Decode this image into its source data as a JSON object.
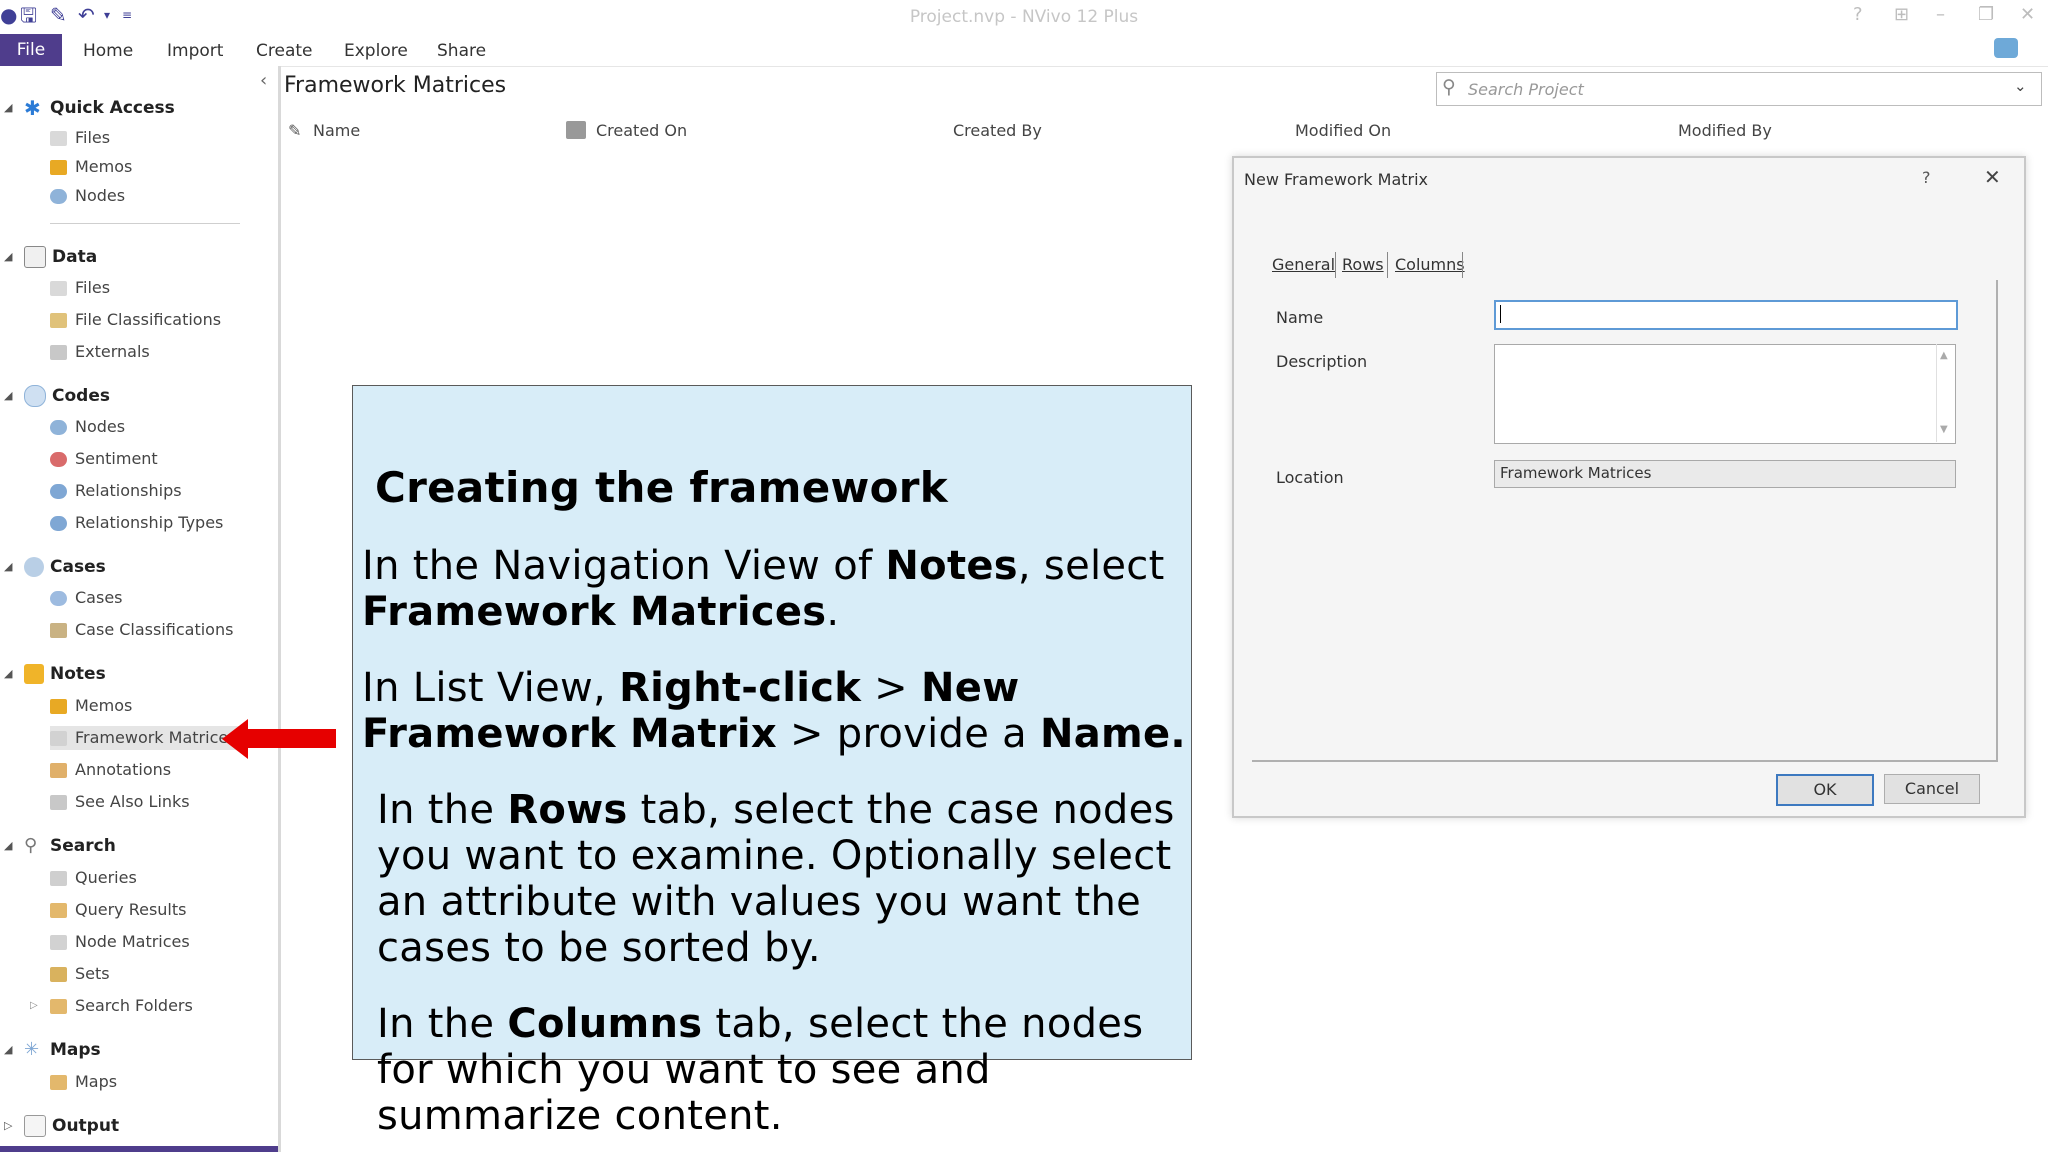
{
  "window": {
    "title": "Project.nvp - NVivo 12 Plus",
    "controls": [
      "?",
      "⊞",
      "–",
      "❐",
      "✕"
    ]
  },
  "quick_access_icons": [
    "save-icon",
    "edit-icon",
    "undo-icon",
    "dropdown-icon",
    "customize-icon"
  ],
  "ribbon": {
    "file_tab": "File",
    "tabs": [
      "Home",
      "Import",
      "Create",
      "Explore",
      "Share"
    ]
  },
  "navigation": {
    "groups": [
      {
        "label": "Quick Access",
        "items": [
          "Files",
          "Memos",
          "Nodes"
        ]
      },
      {
        "label": "Data",
        "items": [
          "Files",
          "File Classifications",
          "Externals"
        ]
      },
      {
        "label": "Codes",
        "items": [
          "Nodes",
          "Sentiment",
          "Relationships",
          "Relationship Types"
        ]
      },
      {
        "label": "Cases",
        "items": [
          "Cases",
          "Case Classifications"
        ]
      },
      {
        "label": "Notes",
        "items": [
          "Memos",
          "Framework Matrices",
          "Annotations",
          "See Also Links"
        ]
      },
      {
        "label": "Search",
        "items": [
          "Queries",
          "Query Results",
          "Node Matrices",
          "Sets",
          "Search Folders"
        ]
      },
      {
        "label": "Maps",
        "items": [
          "Maps"
        ]
      },
      {
        "label": "Output",
        "items": []
      }
    ],
    "selected": "Framework Matrices"
  },
  "list_view": {
    "title": "Framework Matrices",
    "search_placeholder": "Search Project",
    "columns": [
      "Name",
      "Created On",
      "Created By",
      "Modified On",
      "Modified By"
    ]
  },
  "dialog": {
    "title": "New Framework Matrix",
    "help": "?",
    "close": "✕",
    "tabs": [
      "General",
      "Rows",
      "Columns"
    ],
    "active_tab": "General",
    "fields": {
      "name_label": "Name",
      "name_value": "",
      "description_label": "Description",
      "description_value": "",
      "location_label": "Location",
      "location_value": "Framework Matrices"
    },
    "ok": "OK",
    "cancel": "Cancel"
  },
  "callout": {
    "heading": "Creating the framework",
    "p1_a": "In the Navigation View of ",
    "p1_b": "Notes",
    "p1_c": ", select",
    "p1_d": "Framework Matrices",
    "p1_e": ".",
    "p2_a": "In List View, ",
    "p2_b": "Right-click",
    "p2_c": " > ",
    "p2_d": "New",
    "p2_e": "Framework Matrix",
    "p2_f": " > provide a ",
    "p2_g": "Name.",
    "p3_a": "In the ",
    "p3_b": "Rows",
    "p3_c": " tab, select the case nodes",
    "p3_l2": "you want to examine. Optionally select",
    "p3_l3": "an attribute with values you want the",
    "p3_l4": "cases to be sorted by.",
    "p4_a": "In the ",
    "p4_b": "Columns",
    "p4_c": " tab, select the nodes",
    "p4_l2": "for which you want to see and",
    "p4_l3": "summarize content."
  },
  "colors": {
    "ribbon_accent": "#4f3d8c",
    "callout_bg": "#d8edf8",
    "arrow": "#e60000",
    "field_focus": "#5e9ad6"
  }
}
